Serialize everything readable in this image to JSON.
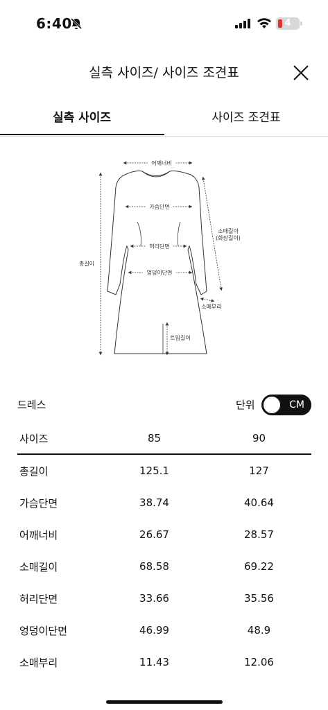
{
  "status_bar": {
    "time": "6:40",
    "battery_level": "4"
  },
  "header": {
    "title": "실측 사이즈/ 사이즈 조견표"
  },
  "tabs": [
    {
      "label": "실측 사이즈",
      "active": true
    },
    {
      "label": "사이즈 조견표",
      "active": false
    }
  ],
  "diagram_labels": {
    "shoulder": "어깨너비",
    "chest": "가슴단면",
    "waist": "허리단면",
    "hip": "엉덩이단면",
    "total_length": "총길이",
    "sleeve_length": "소매길이",
    "sleeve_length_sub": "(화장길이)",
    "cuff": "소매부리",
    "slit": "트임길이"
  },
  "section": {
    "name": "드레스",
    "unit_label": "단위",
    "unit_toggle": "CM"
  },
  "table": {
    "header": [
      "사이즈",
      "85",
      "90"
    ],
    "rows": [
      {
        "name": "총길이",
        "values": [
          "125.1",
          "127"
        ]
      },
      {
        "name": "가슴단면",
        "values": [
          "38.74",
          "40.64"
        ]
      },
      {
        "name": "어깨너비",
        "values": [
          "26.67",
          "28.57"
        ]
      },
      {
        "name": "소매길이",
        "values": [
          "68.58",
          "69.22"
        ]
      },
      {
        "name": "허리단면",
        "values": [
          "33.66",
          "35.56"
        ]
      },
      {
        "name": "엉덩이단면",
        "values": [
          "46.99",
          "48.9"
        ]
      },
      {
        "name": "소매부리",
        "values": [
          "11.43",
          "12.06"
        ]
      }
    ]
  }
}
